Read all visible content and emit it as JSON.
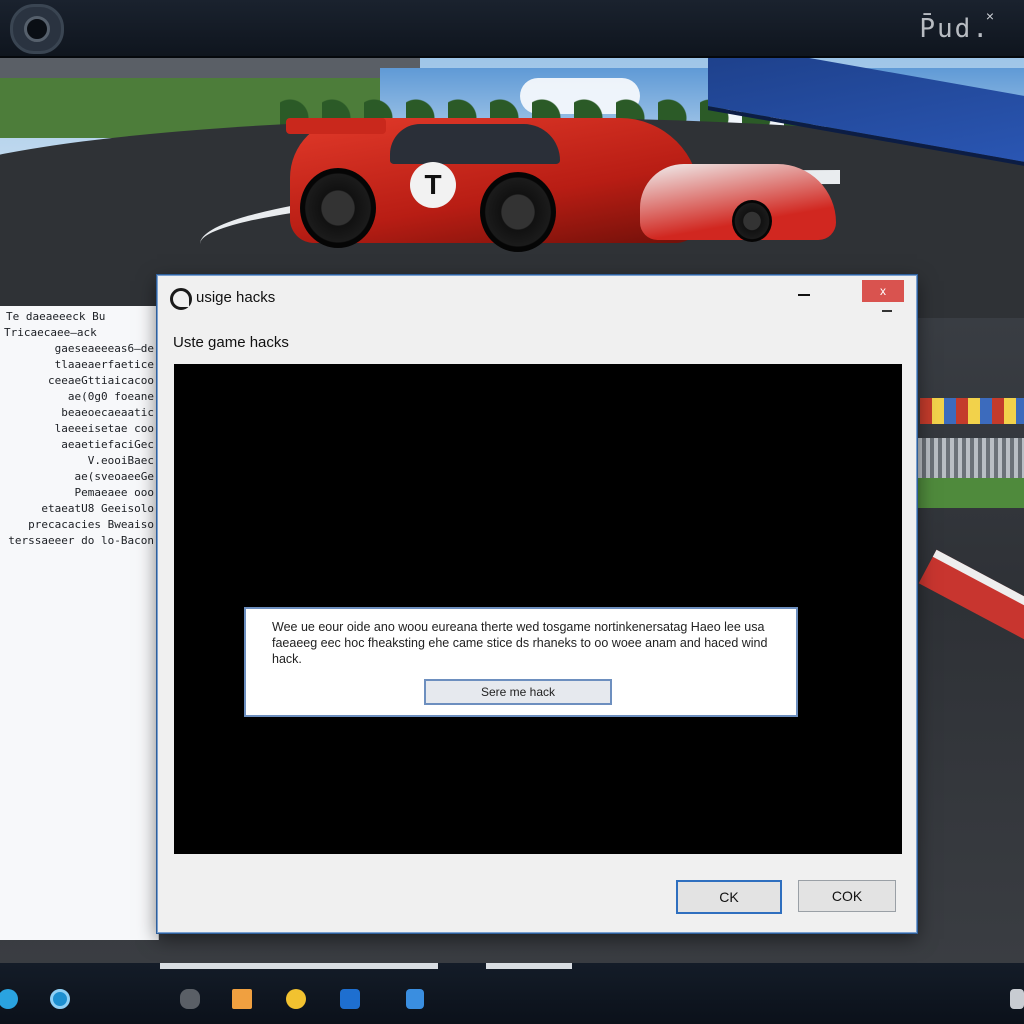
{
  "topbar": {
    "logo": "P̄ud.",
    "close": "×"
  },
  "code_panel": {
    "title": "Te daeaeeeck Bu",
    "lines": [
      "Tricaecaee—ack",
      "gaeseaeeeas6—de",
      "tlaaeaerfaetice",
      "ceeaeGttiaicacoo",
      "ae(0g0  foeane",
      "beaeoecaeaatic",
      "laeeeisetae  coo",
      "aeaetiefaciGec",
      "V.eooiBaec",
      "ae(sveoaeeGe",
      "Pemaeaee ooo",
      "etaeatU8  Geeisolo",
      "precacacies  Bweaiso",
      "terssaeeer  do  lo-Bacon"
    ]
  },
  "dialog": {
    "title": "usige hacks",
    "close_label": "x",
    "subtitle": "Uste game hacks",
    "message": "Wee ue eour oide ano woou eureana therte wed tosgame nortinkenersatag Haeo lee usa faeaeeg eec hoc fheaksting ehe came stice ds rhaneks to oo woee anam and haced wind hack.",
    "message_button": "Sere me hack",
    "ok_button": "CK",
    "ok2_button": "COK"
  },
  "colors": {
    "dialog_bg": "#f0f0f0",
    "content_bg": "#000000",
    "accent": "#2f6fbf",
    "close_red": "#d9534f"
  },
  "taskbar": {
    "icons": [
      {
        "name": "edge-icon",
        "color": "#2aa3e0"
      },
      {
        "name": "browser-icon",
        "color": "#1e90d0"
      },
      {
        "name": "controller-icon",
        "color": "#a0a4aa"
      },
      {
        "name": "folder-icon",
        "color": "#f0a040"
      },
      {
        "name": "arrow-icon",
        "color": "#f2c230"
      },
      {
        "name": "game-app-icon",
        "color": "#1e6fd0"
      },
      {
        "name": "store-icon",
        "color": "#3a8ee0"
      },
      {
        "name": "tray-icon",
        "color": "#c8ccd2"
      }
    ]
  }
}
